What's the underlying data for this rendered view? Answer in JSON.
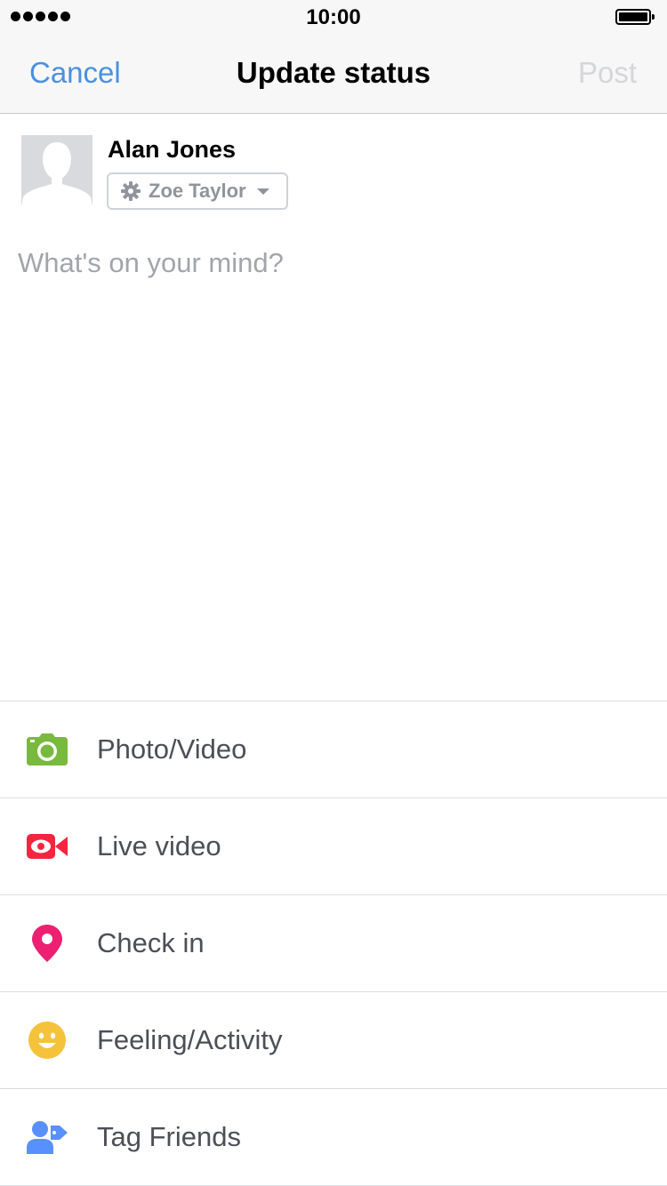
{
  "status_bar": {
    "time": "10:00"
  },
  "nav": {
    "cancel_label": "Cancel",
    "title": "Update status",
    "post_label": "Post"
  },
  "composer": {
    "user_name": "Alan Jones",
    "audience_label": "Zoe Taylor",
    "audience_icon": "gear-icon",
    "placeholder": "What's on your mind?",
    "value": ""
  },
  "options": [
    {
      "label": "Photo/Video",
      "icon": "camera-icon",
      "color": "#78b93e"
    },
    {
      "label": "Live video",
      "icon": "live-video-icon",
      "color": "#f5253f"
    },
    {
      "label": "Check in",
      "icon": "location-pin-icon",
      "color": "#ec1f73"
    },
    {
      "label": "Feeling/Activity",
      "icon": "smiley-icon",
      "color": "#f5c33b"
    },
    {
      "label": "Tag Friends",
      "icon": "tag-friends-icon",
      "color": "#5890ff"
    }
  ],
  "colors": {
    "link_blue": "#4a90e2",
    "post_disabled": "#d4d6da",
    "option_text": "#4b4f56",
    "placeholder": "#a2a5ab"
  }
}
